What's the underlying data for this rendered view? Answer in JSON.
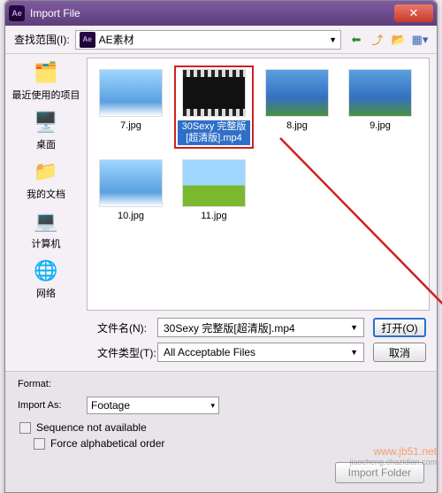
{
  "title": "Import File",
  "toolbar": {
    "lookin_label": "查找范围(I):",
    "folder": "AE素材"
  },
  "sidebar": [
    {
      "icon": "🗂️",
      "label": "最近使用的项目"
    },
    {
      "icon": "🖥️",
      "label": "桌面"
    },
    {
      "icon": "📁",
      "label": "我的文档"
    },
    {
      "icon": "💻",
      "label": "计算机"
    },
    {
      "icon": "🌐",
      "label": "网络"
    }
  ],
  "files": [
    {
      "name": "7.jpg",
      "kind": "sky"
    },
    {
      "name": "30Sexy 完整版[超清版].mp4",
      "kind": "video",
      "selected": true
    },
    {
      "name": "8.jpg",
      "kind": "land"
    },
    {
      "name": "9.jpg",
      "kind": "land"
    },
    {
      "name": "10.jpg",
      "kind": "sky"
    },
    {
      "name": "11.jpg",
      "kind": "flower"
    }
  ],
  "fields": {
    "filename_label": "文件名(N):",
    "filename_value": "30Sexy 完整版[超清版].mp4",
    "filetype_label": "文件类型(T):",
    "filetype_value": "All Acceptable Files",
    "open_label": "打开(O)",
    "cancel_label": "取消"
  },
  "lower": {
    "format_label": "Format:",
    "importas_label": "Import As:",
    "importas_value": "Footage",
    "seq_label": "Sequence not available",
    "force_label": "Force alphabetical order",
    "import_folder": "Import Folder"
  },
  "watermark": {
    "a": "www.jb51.net",
    "b": "jiaocheng.chazidian.com"
  }
}
